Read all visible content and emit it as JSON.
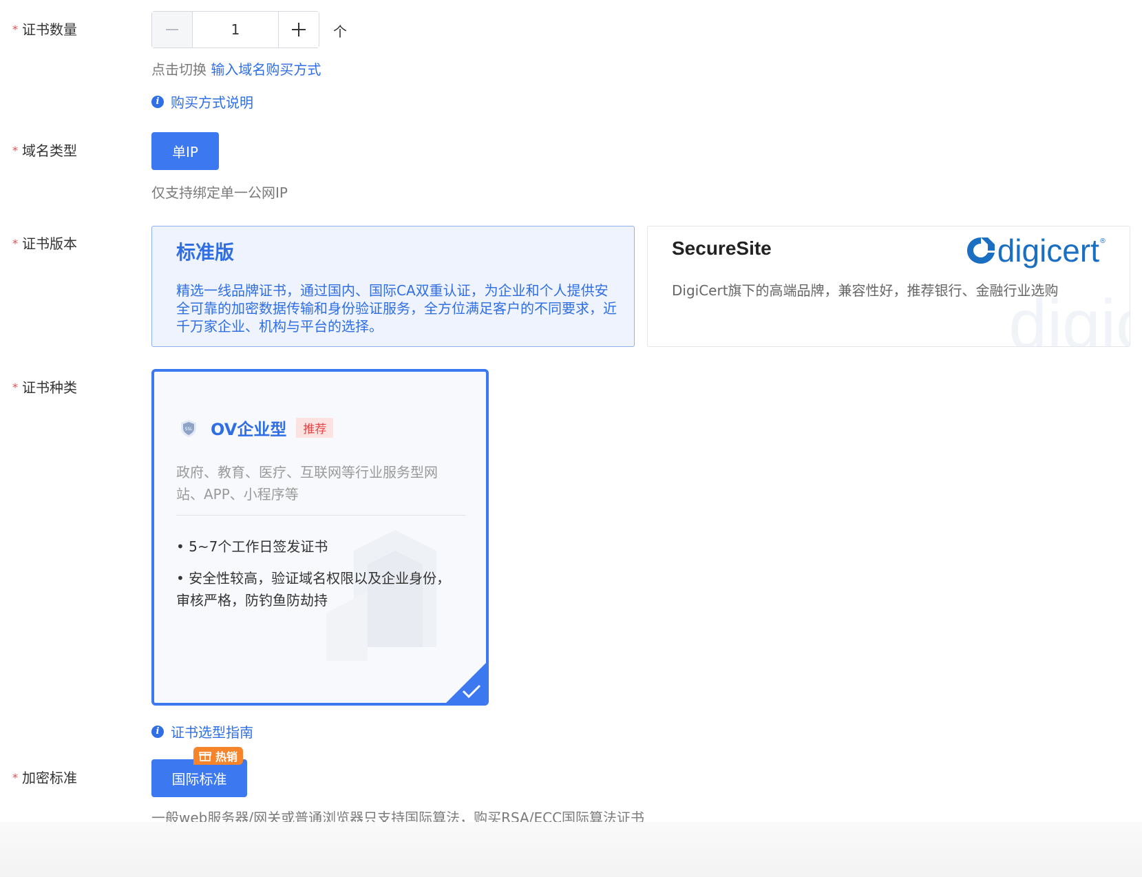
{
  "quantity": {
    "label": "证书数量",
    "value": "1",
    "unit": "个",
    "switch_prefix": "点击切换",
    "switch_link": "输入域名购买方式",
    "help_link": "购买方式说明"
  },
  "domain_type": {
    "label": "域名类型",
    "selected": "单IP",
    "hint": "仅支持绑定单一公网IP"
  },
  "version": {
    "label": "证书版本",
    "cards": [
      {
        "title": "标准版",
        "desc": "精选一线品牌证书，通过国内、国际CA双重认证，为企业和个人提供安全可靠的加密数据传输和身份验证服务，全方位满足客户的不同要求，近千万家企业、机构与平台的选择。",
        "selected": true
      },
      {
        "title": "SecureSite",
        "desc": "DigiCert旗下的高端品牌，兼容性好，推荐银行、金融行业选购",
        "logo_text": "digicert",
        "logo_mark": "®",
        "selected": false
      }
    ]
  },
  "cert_type": {
    "label": "证书种类",
    "card": {
      "name": "OV企业型",
      "badge": "推荐",
      "desc": "政府、教育、医疗、互联网等行业服务型网站、APP、小程序等",
      "features": [
        "• 5~7个工作日签发证书",
        "• 安全性较高，验证域名权限以及企业身份，审核严格，防钓鱼防劫持"
      ],
      "icon_text": "SSL"
    },
    "guide_link": "证书选型指南"
  },
  "encryption": {
    "label": "加密标准",
    "selected": "国际标准",
    "hot_badge": "热销",
    "hint": "一般web服务器/网关或普通浏览器只支持国际算法，购买RSA/ECC国际算法证书"
  },
  "colors": {
    "primary": "#3c78ef",
    "link": "#2f6ee5",
    "required": "#e34d4d",
    "hot": "#f5842a"
  }
}
